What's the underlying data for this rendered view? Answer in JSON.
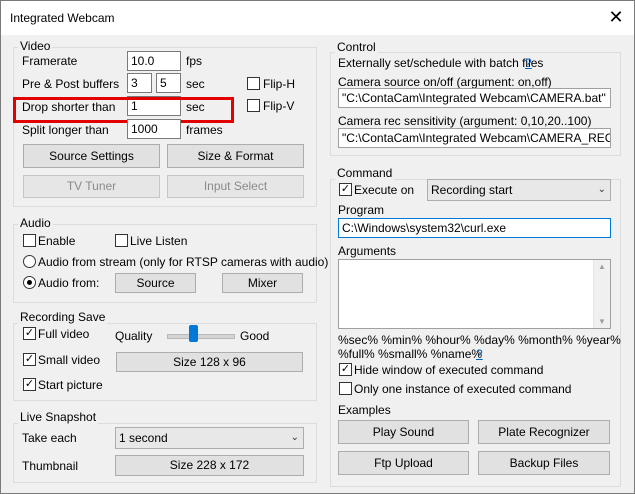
{
  "window": {
    "title": "Integrated Webcam",
    "close_glyph": "✕"
  },
  "video": {
    "group_label": "Video",
    "framerate_label": "Framerate",
    "framerate_value": "10.0",
    "framerate_unit": "fps",
    "prepost_label": "Pre & Post buffers",
    "pre_value": "3",
    "post_value": "5",
    "prepost_unit": "sec",
    "drop_label": "Drop shorter than",
    "drop_value": "1",
    "drop_unit": "sec",
    "split_label": "Split longer than",
    "split_value": "1000",
    "split_unit": "frames",
    "fliph_label": "Flip-H",
    "fliph_checked": false,
    "flipv_label": "Flip-V",
    "flipv_checked": false,
    "source_settings": "Source Settings",
    "size_format": "Size & Format",
    "tv_tuner": "TV Tuner",
    "input_select": "Input Select"
  },
  "audio": {
    "group_label": "Audio",
    "enable_label": "Enable",
    "enable_checked": false,
    "live_listen_label": "Live Listen",
    "live_listen_checked": false,
    "from_stream_label": "Audio from stream (only for RTSP cameras with audio)",
    "from_label": "Audio from:",
    "selected": "from",
    "source_button": "Source",
    "mixer_button": "Mixer"
  },
  "recording": {
    "group_label": "Recording Save",
    "full_video_label": "Full video",
    "full_video_checked": true,
    "quality_label": "Quality",
    "quality_value_label": "Good",
    "quality_level": 0.4,
    "small_video_label": "Small video",
    "small_video_checked": true,
    "small_size_button": "Size 128 x 96",
    "start_picture_label": "Start picture",
    "start_picture_checked": true
  },
  "snapshot": {
    "group_label": "Live Snapshot",
    "take_each_label": "Take each",
    "take_each_value": "1 second",
    "thumbnail_label": "Thumbnail",
    "thumbnail_button": "Size 228 x 172"
  },
  "control": {
    "group_label": "Control",
    "batch_text": "Externally set/schedule with batch files",
    "help": "?",
    "source_onoff_label": "Camera source on/off (argument: on,off)",
    "source_onoff_value": "\"C:\\ContaCam\\Integrated Webcam\\CAMERA.bat\"",
    "rec_sensitivity_label": "Camera rec sensitivity (argument: 0,10,20..100)",
    "rec_sensitivity_value": "\"C:\\ContaCam\\Integrated Webcam\\CAMERA_REC_SENS"
  },
  "command": {
    "group_label": "Command",
    "execute_on_label": "Execute on",
    "execute_on_checked": true,
    "execute_on_value": "Recording start",
    "program_label": "Program",
    "program_value": "C:\\Windows\\system32\\curl.exe",
    "arguments_label": "Arguments",
    "arguments_value": "",
    "placeholders_line1": "%sec% %min% %hour% %day% %month% %year%",
    "placeholders_line2": "%full% %small% %name%",
    "hide_window_label": "Hide window of executed command",
    "hide_window_checked": true,
    "one_instance_label": "Only one instance of executed command",
    "one_instance_checked": false,
    "examples_label": "Examples",
    "play_sound": "Play Sound",
    "plate_recognizer": "Plate Recognizer",
    "ftp_upload": "Ftp Upload",
    "backup_files": "Backup Files"
  },
  "highlight_color": "#e30000"
}
